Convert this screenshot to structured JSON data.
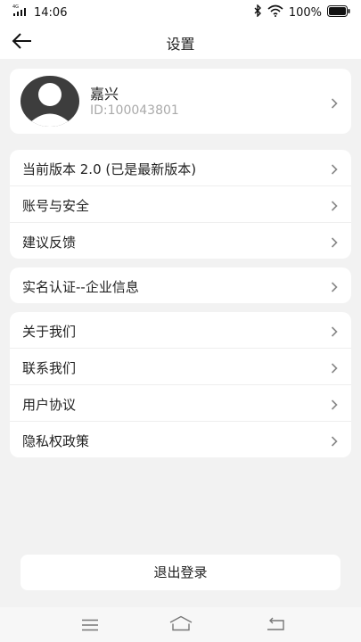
{
  "status": {
    "time": "14:06",
    "network": "4G",
    "battery": "100%"
  },
  "header": {
    "title": "设置"
  },
  "profile": {
    "name": "嘉兴",
    "id": "ID:100043801"
  },
  "group1": [
    {
      "label": "当前版本 2.0 (已是最新版本)"
    },
    {
      "label": "账号与安全"
    },
    {
      "label": "建议反馈"
    }
  ],
  "group2": [
    {
      "label": "实名认证--企业信息"
    }
  ],
  "group3": [
    {
      "label": "关于我们"
    },
    {
      "label": "联系我们"
    },
    {
      "label": "用户协议"
    },
    {
      "label": "隐私权政策"
    }
  ],
  "logout": {
    "label": "退出登录"
  }
}
